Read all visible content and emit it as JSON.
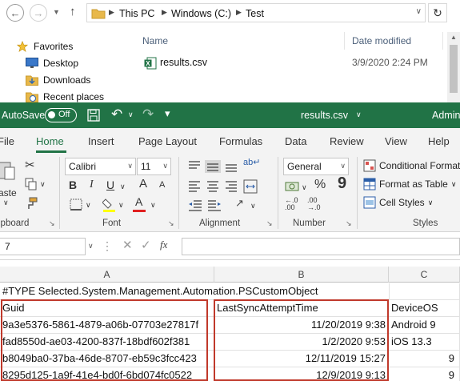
{
  "explorer": {
    "breadcrumb": [
      "This PC",
      "Windows (C:)",
      "Test"
    ],
    "nav_items": [
      "Favorites",
      "Desktop",
      "Downloads",
      "Recent places"
    ],
    "columns": [
      "Name",
      "Date modified"
    ],
    "file": {
      "name": "results.csv",
      "date_modified": "3/9/2020 2:24 PM"
    }
  },
  "excel": {
    "autosave_label": "AutoSave",
    "autosave_state": "Off",
    "doc_title": "results.csv",
    "user": "Admin",
    "tabs": [
      "File",
      "Home",
      "Insert",
      "Page Layout",
      "Formulas",
      "Data",
      "Review",
      "View",
      "Help"
    ],
    "active_tab": "Home",
    "ribbon": {
      "paste_label": "aste",
      "clipboard_label": "ipboard",
      "font_name": "Calibri",
      "font_size": "11",
      "bold": "B",
      "italic": "I",
      "underline": "U",
      "increase_font": "A",
      "decrease_font": "A",
      "font_color_letter": "A",
      "font_label": "Font",
      "alignment_label": "Alignment",
      "number_format": "General",
      "currency_symbol": "$",
      "percent_symbol": "%",
      "comma_symbol": "9",
      "number_label": "Number",
      "conditional_formatting": "Conditional Format",
      "format_as_table": "Format as Table",
      "cell_styles": "Cell Styles",
      "styles_label": "Styles"
    },
    "namebox_value": "7",
    "fx_label": "fx",
    "columns": [
      "A",
      "B",
      "C"
    ],
    "rows": [
      {
        "a": "#TYPE Selected.System.Management.Automation.PSCustomObject",
        "b": "",
        "c": ""
      },
      {
        "a": "Guid",
        "b": "LastSyncAttemptTime",
        "c": "DeviceOS"
      },
      {
        "a": "9a3e5376-5861-4879-a06b-07703e27817f",
        "b": "11/20/2019 9:38",
        "c": "Android 9"
      },
      {
        "a": "fad8550d-ae03-4200-837f-18bdf602f381",
        "b": "1/2/2020 9:53",
        "c": "iOS 13.3"
      },
      {
        "a": "b8049ba0-37ba-46de-8707-eb59c3fcc423",
        "b": "12/11/2019 15:27",
        "c": "9"
      },
      {
        "a": "8295d125-1a9f-41e4-bd0f-6bd074fc0522",
        "b": "12/9/2019 9:13",
        "c": "9"
      }
    ]
  },
  "colors": {
    "excel_green": "#217346",
    "highlight_red": "#c0392b",
    "folder_yellow": "#e8b84a"
  }
}
